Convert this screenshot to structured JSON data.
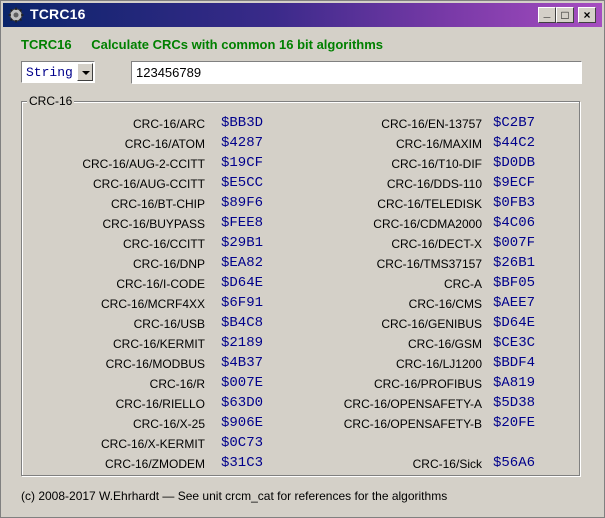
{
  "window": {
    "title": "TCRC16",
    "buttons": {
      "minimize": "_",
      "maximize": "□",
      "close": "×"
    }
  },
  "header": {
    "app_name": "TCRC16",
    "tagline": "Calculate CRCs with common 16 bit algorithms"
  },
  "input_type": {
    "selected": "String"
  },
  "input_value": "123456789",
  "group": {
    "label": "CRC-16"
  },
  "results_left": [
    {
      "name": "CRC-16/ARC",
      "value": "$BB3D"
    },
    {
      "name": "CRC-16/ATOM",
      "value": "$4287"
    },
    {
      "name": "CRC-16/AUG-2-CCITT",
      "value": "$19CF"
    },
    {
      "name": "CRC-16/AUG-CCITT",
      "value": "$E5CC"
    },
    {
      "name": "CRC-16/BT-CHIP",
      "value": "$89F6"
    },
    {
      "name": "CRC-16/BUYPASS",
      "value": "$FEE8"
    },
    {
      "name": "CRC-16/CCITT",
      "value": "$29B1"
    },
    {
      "name": "CRC-16/DNP",
      "value": "$EA82"
    },
    {
      "name": "CRC-16/I-CODE",
      "value": "$D64E"
    },
    {
      "name": "CRC-16/MCRF4XX",
      "value": "$6F91"
    },
    {
      "name": "CRC-16/USB",
      "value": "$B4C8"
    },
    {
      "name": "CRC-16/KERMIT",
      "value": "$2189"
    },
    {
      "name": "CRC-16/MODBUS",
      "value": "$4B37"
    },
    {
      "name": "CRC-16/R",
      "value": "$007E"
    },
    {
      "name": "CRC-16/RIELLO",
      "value": "$63D0"
    },
    {
      "name": "CRC-16/X-25",
      "value": "$906E"
    },
    {
      "name": "CRC-16/X-KERMIT",
      "value": "$0C73"
    },
    {
      "name": "CRC-16/ZMODEM",
      "value": "$31C3"
    }
  ],
  "results_right": [
    {
      "name": "CRC-16/EN-13757",
      "value": "$C2B7"
    },
    {
      "name": "CRC-16/MAXIM",
      "value": "$44C2"
    },
    {
      "name": "CRC-16/T10-DIF",
      "value": "$D0DB"
    },
    {
      "name": "CRC-16/DDS-110",
      "value": "$9ECF"
    },
    {
      "name": "CRC-16/TELEDISK",
      "value": "$0FB3"
    },
    {
      "name": "CRC-16/CDMA2000",
      "value": "$4C06"
    },
    {
      "name": "CRC-16/DECT-X",
      "value": "$007F"
    },
    {
      "name": "CRC-16/TMS37157",
      "value": "$26B1"
    },
    {
      "name": "CRC-A",
      "value": "$BF05"
    },
    {
      "name": "CRC-16/CMS",
      "value": "$AEE7"
    },
    {
      "name": "CRC-16/GENIBUS",
      "value": "$D64E"
    },
    {
      "name": "CRC-16/GSM",
      "value": "$CE3C"
    },
    {
      "name": "CRC-16/LJ1200",
      "value": "$BDF4"
    },
    {
      "name": "CRC-16/PROFIBUS",
      "value": "$A819"
    },
    {
      "name": "CRC-16/OPENSAFETY-A",
      "value": "$5D38"
    },
    {
      "name": "CRC-16/OPENSAFETY-B",
      "value": "$20FE"
    },
    {
      "name": "",
      "value": ""
    },
    {
      "name": "CRC-16/Sick",
      "value": "$56A6"
    }
  ],
  "footer": "(c) 2008-2017 W.Ehrhardt  —  See unit crcm_cat for references for the algorithms"
}
